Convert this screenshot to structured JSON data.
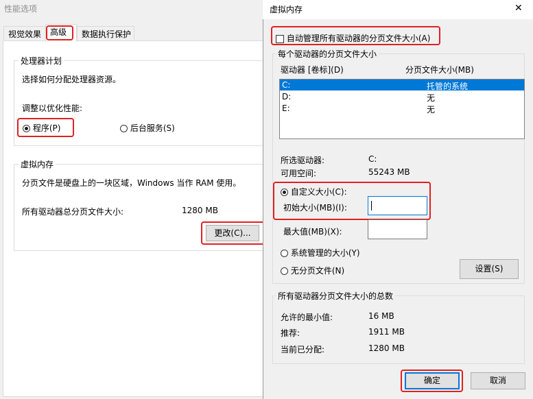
{
  "back_window": {
    "title": "性能选项",
    "tabs": [
      {
        "label": "视觉效果"
      },
      {
        "label": "高级"
      },
      {
        "label": "数据执行保护"
      }
    ],
    "processor_group": {
      "title": "处理器计划",
      "description": "选择如何分配处理器资源。",
      "adjust_label": "调整以优化性能:",
      "option_programs": "程序(P)",
      "option_background": "后台服务(S)"
    },
    "vm_group": {
      "title": "虚拟内存",
      "description": "分页文件是硬盘上的一块区域，Windows 当作 RAM 使用。",
      "total_label": "所有驱动器总分页文件大小:",
      "total_value": "1280 MB",
      "change_button": "更改(C)..."
    }
  },
  "dialog": {
    "title": "虚拟内存",
    "close_glyph": "✕",
    "auto_manage_label": "自动管理所有驱动器的分页文件大小(A)",
    "auto_manage_checked": false,
    "per_drive_group": {
      "title": "每个驱动器的分页文件大小",
      "col_drive": "驱动器 [卷标](D)",
      "col_size": "分页文件大小(MB)",
      "rows": [
        {
          "drive": "C:",
          "size": "托管的系统",
          "selected": true
        },
        {
          "drive": "D:",
          "size": "无",
          "selected": false
        },
        {
          "drive": "E:",
          "size": "无",
          "selected": false
        }
      ],
      "selected_drive_label": "所选驱动器:",
      "selected_drive_value": "C:",
      "free_space_label": "可用空间:",
      "free_space_value": "55243 MB",
      "custom_size_label": "自定义大小(C):",
      "initial_size_label": "初始大小(MB)(I):",
      "initial_size_value": "",
      "max_size_label": "最大值(MB)(X):",
      "max_size_value": "",
      "system_managed_label": "系统管理的大小(Y)",
      "no_paging_label": "无分页文件(N)",
      "set_button": "设置(S)"
    },
    "totals_group": {
      "title": "所有驱动器分页文件大小的总数",
      "min_label": "允许的最小值:",
      "min_value": "16 MB",
      "recommended_label": "推荐:",
      "recommended_value": "1911 MB",
      "allocated_label": "当前已分配:",
      "allocated_value": "1280 MB"
    },
    "ok_button": "确定",
    "cancel_button": "取消"
  },
  "colors": {
    "highlight": "#e02020",
    "selection": "#0078d7"
  }
}
